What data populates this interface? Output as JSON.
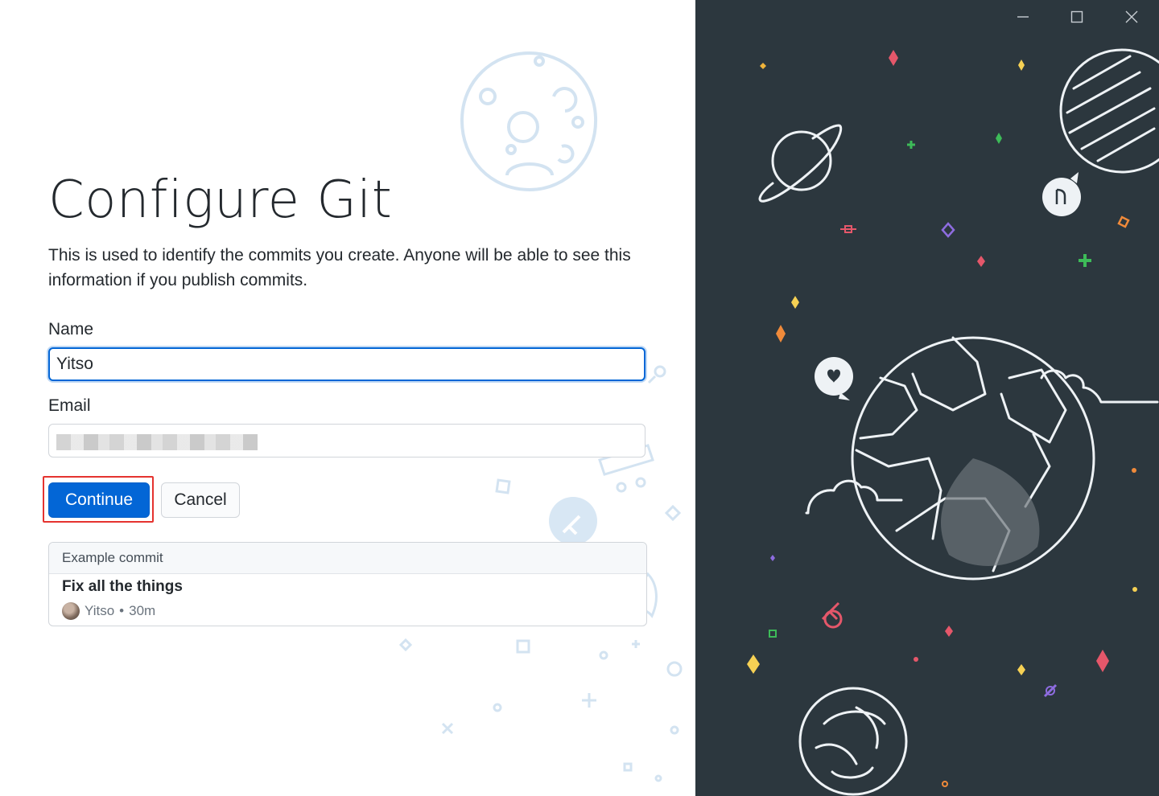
{
  "title": "Configure Git",
  "description": "This is used to identify the commits you create. Anyone will be able to see this information if you publish commits.",
  "form": {
    "name_label": "Name",
    "name_value": "Yitso",
    "email_label": "Email",
    "email_value": ""
  },
  "buttons": {
    "continue": "Continue",
    "cancel": "Cancel"
  },
  "example": {
    "header": "Example commit",
    "commit_title": "Fix all the things",
    "author": "Yitso",
    "separator": "•",
    "time": "30m"
  },
  "window_controls": [
    "minimize",
    "maximize",
    "close"
  ],
  "colors": {
    "primary": "#0366d6",
    "right_panel_bg": "#2c373e",
    "highlight": "#e5332f"
  }
}
